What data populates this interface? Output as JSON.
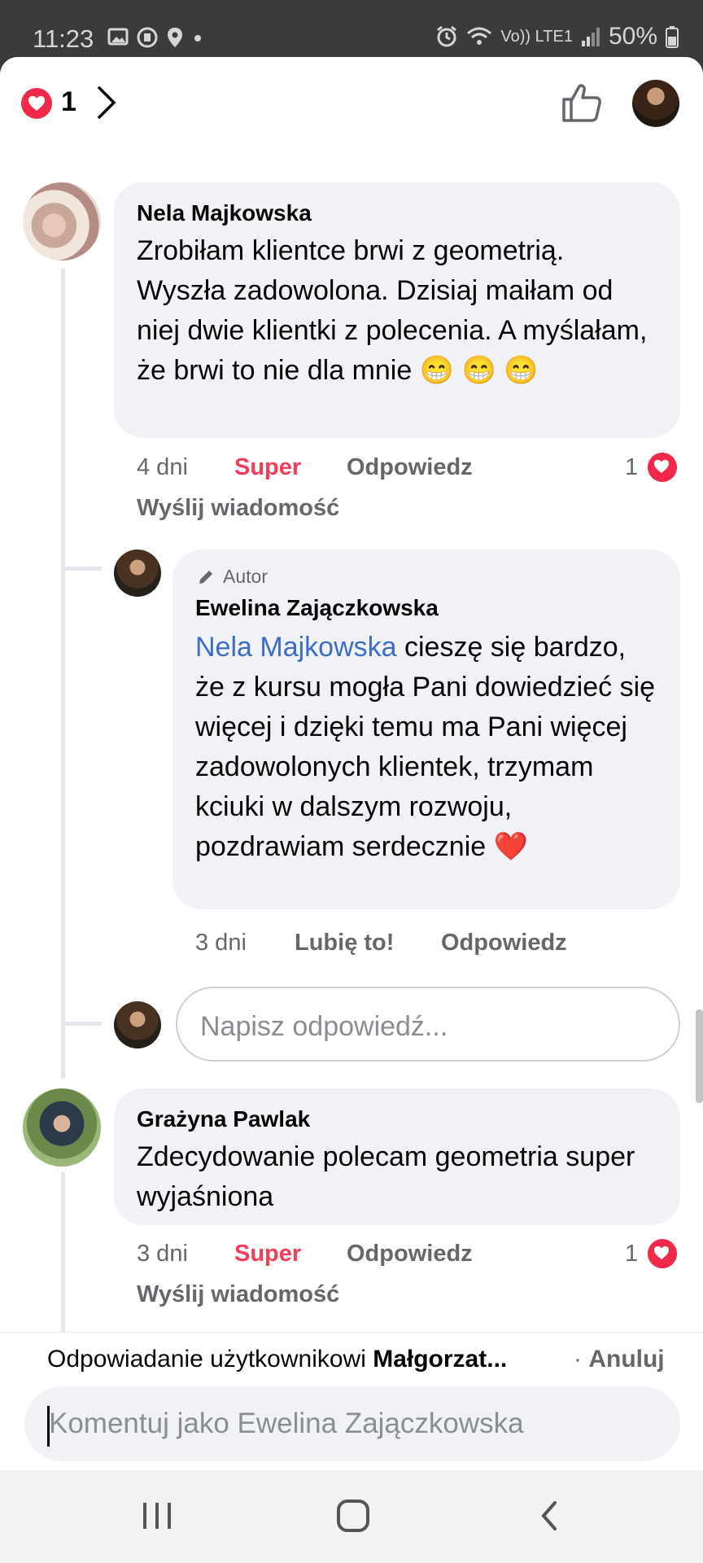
{
  "status_bar": {
    "time": "11:23",
    "network_label": "Vo)) LTE1",
    "battery": "50%"
  },
  "top_bar": {
    "reaction_count": "1"
  },
  "comments": [
    {
      "author": "Nela Majkowska",
      "text": "Zrobiłam klientce brwi z geometrią. Wyszła zadowolona. Dzisiaj maiłam od niej dwie klientki z polecenia. A myślałam, że brwi to nie dla mnie 😁 😁 😁",
      "age": "4 dni",
      "reaction_label": "Super",
      "reply_label": "Odpowiedz",
      "send_message_label": "Wyślij wiadomość",
      "reaction_count": "1",
      "replies": [
        {
          "badge": "Autor",
          "author": "Ewelina Zajączkowska",
          "mention": "Nela Majkowska",
          "text": " cieszę się bardzo, że z kursu mogła Pani dowiedzieć się więcej i dzięki temu ma Pani więcej zadowolonych klientek, trzymam kciuki w dalszym rozwoju, pozdrawiam serdecznie ❤️",
          "age": "3 dni",
          "like_label": "Lubię to!",
          "reply_label": "Odpowiedz"
        }
      ],
      "reply_placeholder": "Napisz odpowiedź..."
    },
    {
      "author": "Grażyna Pawlak",
      "text": "Zdecydowanie polecam geometria super wyjaśniona",
      "age": "3 dni",
      "reaction_label": "Super",
      "reply_label": "Odpowiedz",
      "send_message_label": "Wyślij wiadomość",
      "reaction_count": "1"
    }
  ],
  "replying_bar": {
    "prefix": "Odpowiadanie użytkownikowi ",
    "user": "Małgorzat...",
    "separator": " · ",
    "cancel": "Anuluj"
  },
  "composer": {
    "placeholder": "Komentuj jako Ewelina Zajączkowska"
  },
  "colors": {
    "reaction_red": "#f02849",
    "super_text": "#f33e58",
    "mention_blue": "#3c6bc8",
    "bubble_bg": "#f0f2f5",
    "meta_gray": "#65676b"
  }
}
